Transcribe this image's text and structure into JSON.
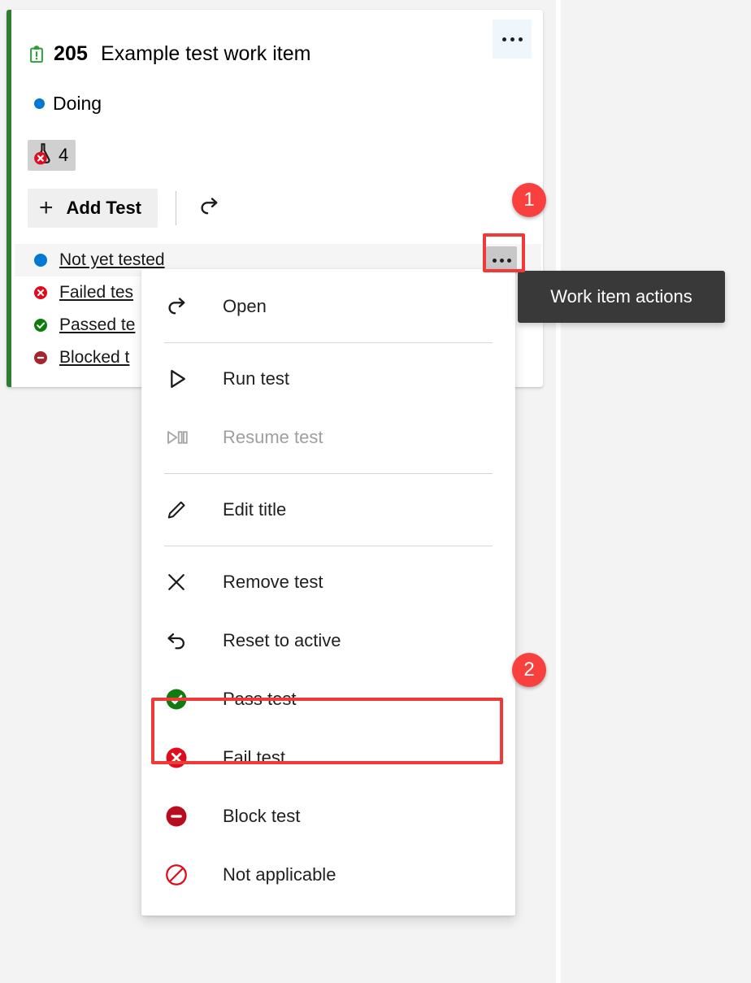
{
  "card": {
    "work_item_icon": "task-clipboard-icon",
    "id": "205",
    "title": "Example test work item",
    "state": "Doing",
    "state_color": "#0078D4",
    "accent_color": "#2E7D32",
    "badge": {
      "icon": "failed-test-flask-icon",
      "count": "4"
    },
    "menu_button_label": "•••"
  },
  "toolbar": {
    "add_test_label": "Add Test",
    "add_test_icon": "plus-icon",
    "refresh_icon": "refresh-arrow-icon"
  },
  "test_list": [
    {
      "label": "Not yet tested",
      "status": "not-run",
      "status_color": "#0078D4",
      "highlighted": true
    },
    {
      "label": "Failed tes",
      "status": "failed",
      "status_color": "#E81123",
      "highlighted": false
    },
    {
      "label": "Passed te",
      "status": "passed",
      "status_color": "#107C10",
      "highlighted": false
    },
    {
      "label": "Blocked t",
      "status": "blocked",
      "status_color": "#A4262C",
      "highlighted": false
    }
  ],
  "context_menu": {
    "groups": [
      {
        "items": [
          {
            "label": "Open",
            "icon": "open-arrow-icon",
            "disabled": false,
            "highlighted": false
          }
        ]
      },
      {
        "items": [
          {
            "label": "Run test",
            "icon": "play-icon",
            "disabled": false,
            "highlighted": false
          },
          {
            "label": "Resume test",
            "icon": "resume-play-pause-icon",
            "disabled": true,
            "highlighted": false
          }
        ]
      },
      {
        "items": [
          {
            "label": "Edit title",
            "icon": "pencil-icon",
            "disabled": false,
            "highlighted": false
          }
        ]
      },
      {
        "items": [
          {
            "label": "Remove test",
            "icon": "close-x-icon",
            "disabled": false,
            "highlighted": false
          },
          {
            "label": "Reset to active",
            "icon": "undo-arrow-icon",
            "disabled": false,
            "highlighted": false
          },
          {
            "label": "Pass test",
            "icon": "pass-check-circle-icon",
            "disabled": false,
            "highlighted": true
          },
          {
            "label": "Fail test",
            "icon": "fail-x-circle-icon",
            "disabled": false,
            "highlighted": false
          },
          {
            "label": "Block test",
            "icon": "block-minus-circle-icon",
            "disabled": false,
            "highlighted": false
          },
          {
            "label": "Not applicable",
            "icon": "not-applicable-slash-circle-icon",
            "disabled": false,
            "highlighted": false
          }
        ]
      }
    ]
  },
  "tooltip": {
    "text": "Work item actions",
    "background": "#393939"
  },
  "annotations": {
    "marker_color": "#F8403F",
    "markers": [
      {
        "number": "1",
        "target": "row-menu-button"
      },
      {
        "number": "2",
        "target": "pass-test-menu-item"
      }
    ]
  }
}
